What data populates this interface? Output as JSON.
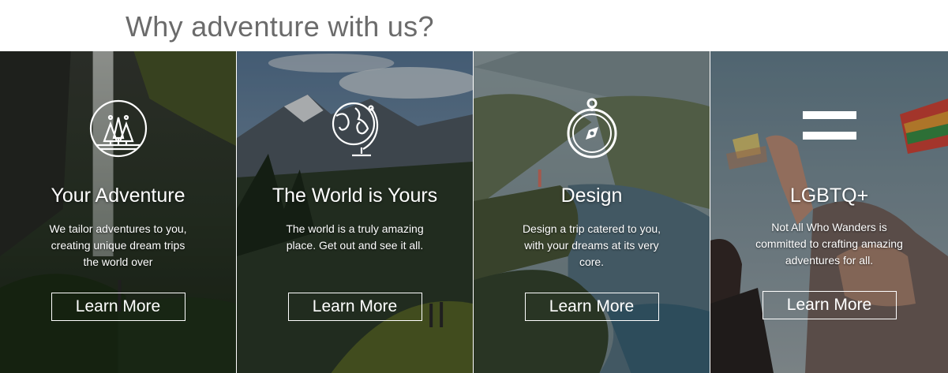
{
  "page": {
    "title": "Why adventure with us?"
  },
  "panels": [
    {
      "icon": "trees-icon",
      "title": "Your Adventure",
      "description": "We tailor adventures to you,  creating unique dream trips the world over",
      "button": "Learn More"
    },
    {
      "icon": "globe-icon",
      "title": "The World is Yours",
      "description": "The world is a truly amazing place. Get out and see it all.",
      "button": "Learn More"
    },
    {
      "icon": "compass-icon",
      "title": "Design",
      "description": "Design a trip catered to you, with your dreams at its very core.",
      "button": "Learn More"
    },
    {
      "icon": "equals-icon",
      "title": "LGBTQ+",
      "description": "Not All Who Wanders is committed to crafting amazing adventures for all.",
      "button": "Learn More"
    }
  ],
  "colors": {
    "title_text": "#6b6b6b",
    "overlay_text": "#ffffff"
  }
}
